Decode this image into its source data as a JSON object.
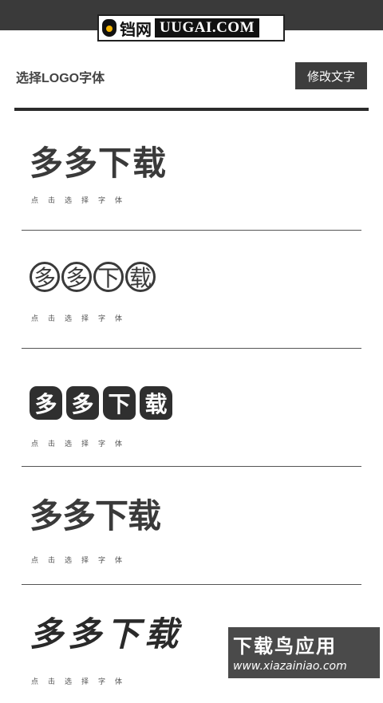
{
  "topbar": {
    "brand_cn": "铛网",
    "brand_en": "UUGAI.COM"
  },
  "header": {
    "title": "选择LOGO字体",
    "edit_button": "修改文字"
  },
  "fonts": [
    {
      "preview": "多多下载",
      "caption": "点击选择字体",
      "style": "heavy-serif"
    },
    {
      "preview_chars": [
        "多",
        "多",
        "下",
        "载"
      ],
      "caption": "点击选择字体",
      "style": "circled"
    },
    {
      "preview_chars": [
        "多",
        "多",
        "下",
        "载"
      ],
      "caption": "点击选择字体",
      "style": "stamp"
    },
    {
      "preview": "多多下载",
      "caption": "点击选择字体",
      "style": "geometric"
    },
    {
      "preview": "多多下载",
      "caption": "点击选择字体",
      "style": "brush"
    }
  ],
  "watermark": {
    "main": "下载鸟应用",
    "sub": "www.xiazainiao.com"
  }
}
